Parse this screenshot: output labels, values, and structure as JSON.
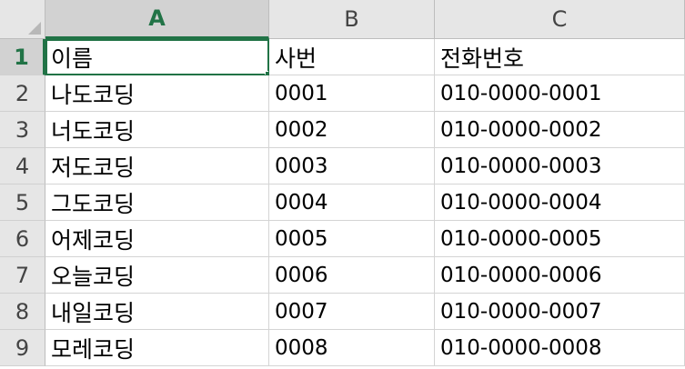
{
  "columns": [
    "A",
    "B",
    "C"
  ],
  "rows": [
    {
      "num": "1",
      "cells": [
        "이름",
        "사번",
        "전화번호"
      ]
    },
    {
      "num": "2",
      "cells": [
        "나도코딩",
        "0001",
        "010-0000-0001"
      ]
    },
    {
      "num": "3",
      "cells": [
        "너도코딩",
        "0002",
        "010-0000-0002"
      ]
    },
    {
      "num": "4",
      "cells": [
        "저도코딩",
        "0003",
        "010-0000-0003"
      ]
    },
    {
      "num": "5",
      "cells": [
        "그도코딩",
        "0004",
        "010-0000-0004"
      ]
    },
    {
      "num": "6",
      "cells": [
        "어제코딩",
        "0005",
        "010-0000-0005"
      ]
    },
    {
      "num": "7",
      "cells": [
        "오늘코딩",
        "0006",
        "010-0000-0006"
      ]
    },
    {
      "num": "8",
      "cells": [
        "내일코딩",
        "0007",
        "010-0000-0007"
      ]
    },
    {
      "num": "9",
      "cells": [
        "모레코딩",
        "0008",
        "010-0000-0008"
      ]
    }
  ],
  "selection": {
    "column": "A",
    "row": "1"
  },
  "colors": {
    "accent": "#217346",
    "header_bg": "#e6e6e6",
    "grid": "#d4d4d4"
  }
}
